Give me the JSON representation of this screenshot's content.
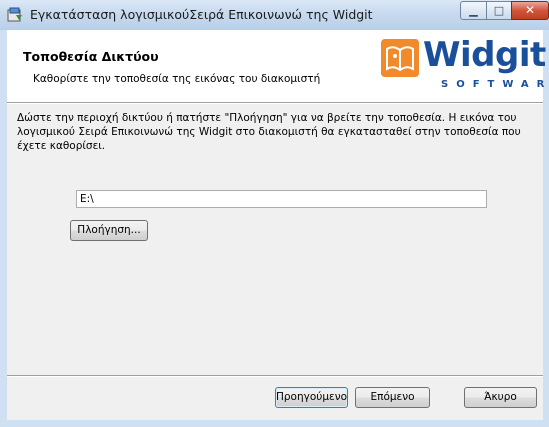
{
  "window": {
    "title": "Εγκατάσταση λογισμικούΣειρά Επικοινωνώ της Widgit",
    "controls": {
      "minimize": "▁",
      "maximize": "□",
      "close": "✕"
    }
  },
  "banner": {
    "title": "Τοποθεσία Δικτύου",
    "subtitle": "Καθορίστε την τοποθεσία της εικόνας του διακομιστή",
    "logo": {
      "word": "Widgit",
      "sub": "SOFTWARE",
      "icon": "widgit-book-icon"
    }
  },
  "body": {
    "description": "Δώστε την περιοχή δικτύου ή πατήστε \"Πλοήγηση\" για να βρείτε την τοποθεσία. Η εικόνα του λογισμικού Σειρά Επικοινωνώ της Widgit στο διακομιστή θα εγκατασταθεί στην τοποθεσία που έχετε καθορίσει.",
    "path_value": "E:\\",
    "browse_label": "Πλοήγηση..."
  },
  "footer": {
    "back_label": "Προηγούμενο",
    "next_label": "Επόμενο",
    "cancel_label": "Άκυρο"
  },
  "colors": {
    "accent": "#1a4f9c",
    "logo_orange": "#f08a2a",
    "close": "#c13e22"
  }
}
